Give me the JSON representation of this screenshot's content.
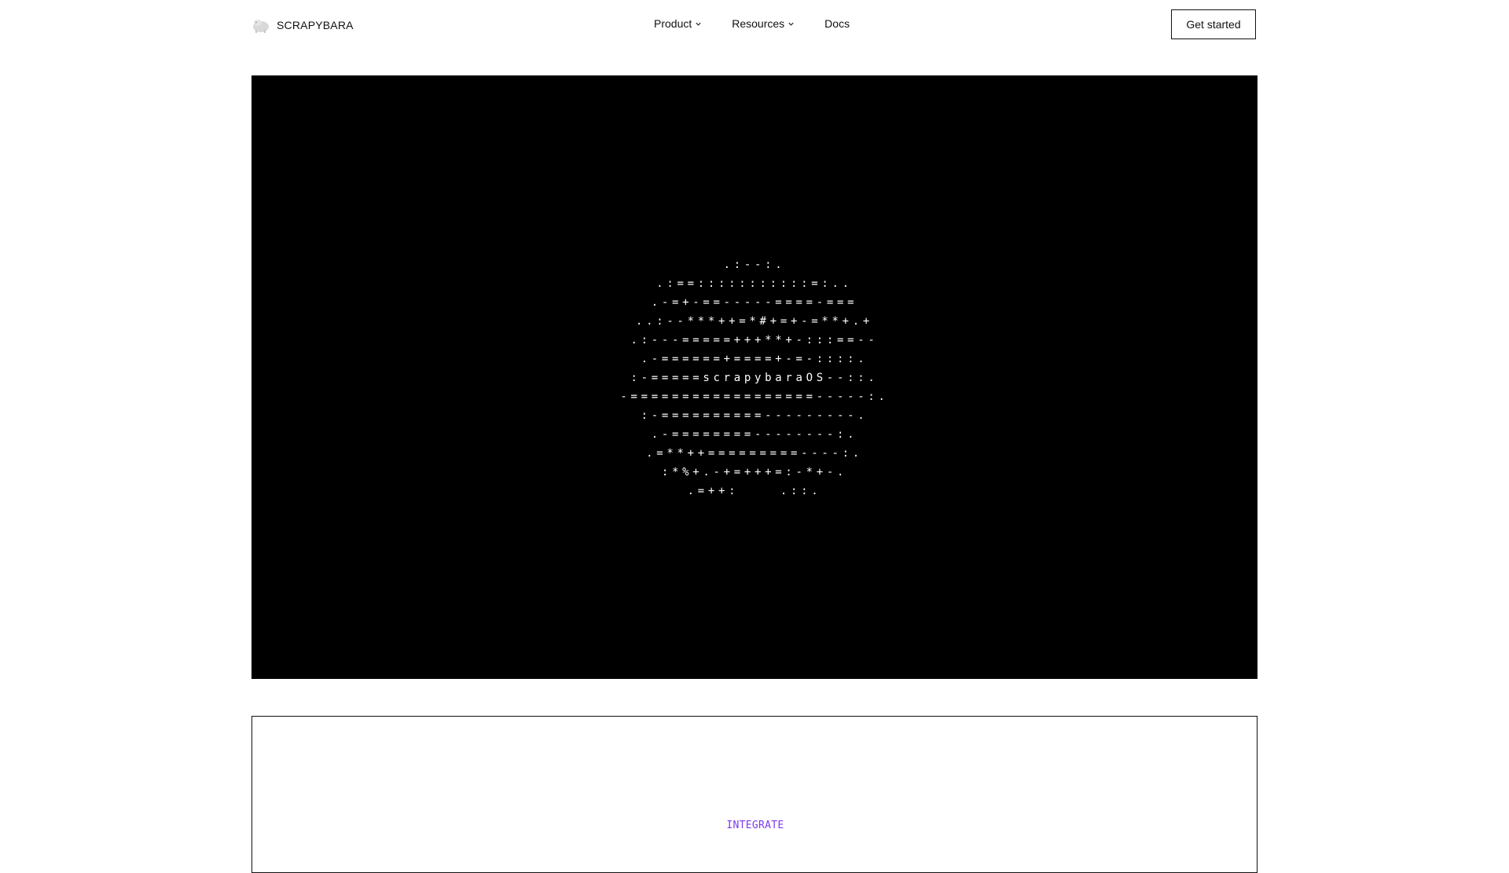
{
  "brand": {
    "name": "SCRAPYBARA",
    "logo_icon": "capybara-logo-icon"
  },
  "nav": {
    "items": [
      {
        "label": "Product",
        "has_dropdown": true
      },
      {
        "label": "Resources",
        "has_dropdown": true
      },
      {
        "label": "Docs",
        "has_dropdown": false
      }
    ]
  },
  "cta": {
    "label": "Get started"
  },
  "hero": {
    "background_color": "#000000",
    "ascii_art": [
      ".:--:.",
      ".:==:::::::::::=:..",
      ".-=+-==-----====-===",
      "..:--***++=*#+=+-=**+.+",
      ".:---=====+++**+-:::==--",
      ".-======+====+-=-::::.",
      ":-=====scrapybaraOS--::.",
      "-==================-----:.",
      ":-==========---------.",
      ".-========--------:.",
      ".=**++=========----:.",
      ":*%+.-+=+++=:-*+-.",
      ".=++:    .::."
    ]
  },
  "section": {
    "tag": "INTEGRATE",
    "tag_color": "#7c3aed"
  }
}
